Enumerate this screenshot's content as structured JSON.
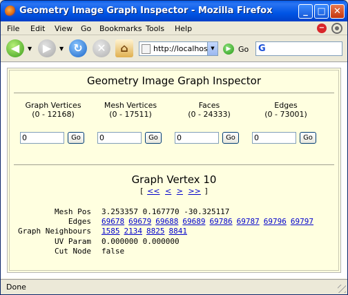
{
  "window": {
    "title": "Geometry Image Graph Inspector - Mozilla Firefox",
    "min": "_",
    "max": "□",
    "close": "✕"
  },
  "menu": [
    "File",
    "Edit",
    "View",
    "Go",
    "Bookmarks",
    "Tools",
    "Help"
  ],
  "nav": {
    "url": "http://localhos",
    "go_label": "Go",
    "search_icon": "G"
  },
  "page": {
    "title": "Geometry Image Graph Inspector",
    "columns": [
      {
        "caption": "Graph Vertices",
        "range": "(0 - 12168)",
        "value": "0",
        "button": "Go"
      },
      {
        "caption": "Mesh Vertices",
        "range": "(0 - 17511)",
        "value": "0",
        "button": "Go"
      },
      {
        "caption": "Faces",
        "range": "(0 - 24333)",
        "value": "0",
        "button": "Go"
      },
      {
        "caption": "Edges",
        "range": "(0 - 73001)",
        "value": "0",
        "button": "Go"
      }
    ],
    "vertex_title": "Graph Vertex 10",
    "vertex_nav": {
      "open": "[",
      "first": "<<",
      "prev": "<",
      "next": ">",
      "last": ">>",
      "close": "]"
    },
    "details": {
      "mesh_pos_label": "Mesh Pos",
      "mesh_pos": "3.253357 0.167770 -30.325117",
      "edges_label": "Edges",
      "edges": [
        "69678",
        "69679",
        "69688",
        "69689",
        "69786",
        "69787",
        "69796",
        "69797"
      ],
      "neighbours_label": "Graph Neighbours",
      "neighbours": [
        "1585",
        "2134",
        "8825",
        "8841"
      ],
      "uv_label": "UV Param",
      "uv": "0.000000 0.000000",
      "cut_label": "Cut Node",
      "cut": "false"
    }
  },
  "status": {
    "text": "Done"
  }
}
